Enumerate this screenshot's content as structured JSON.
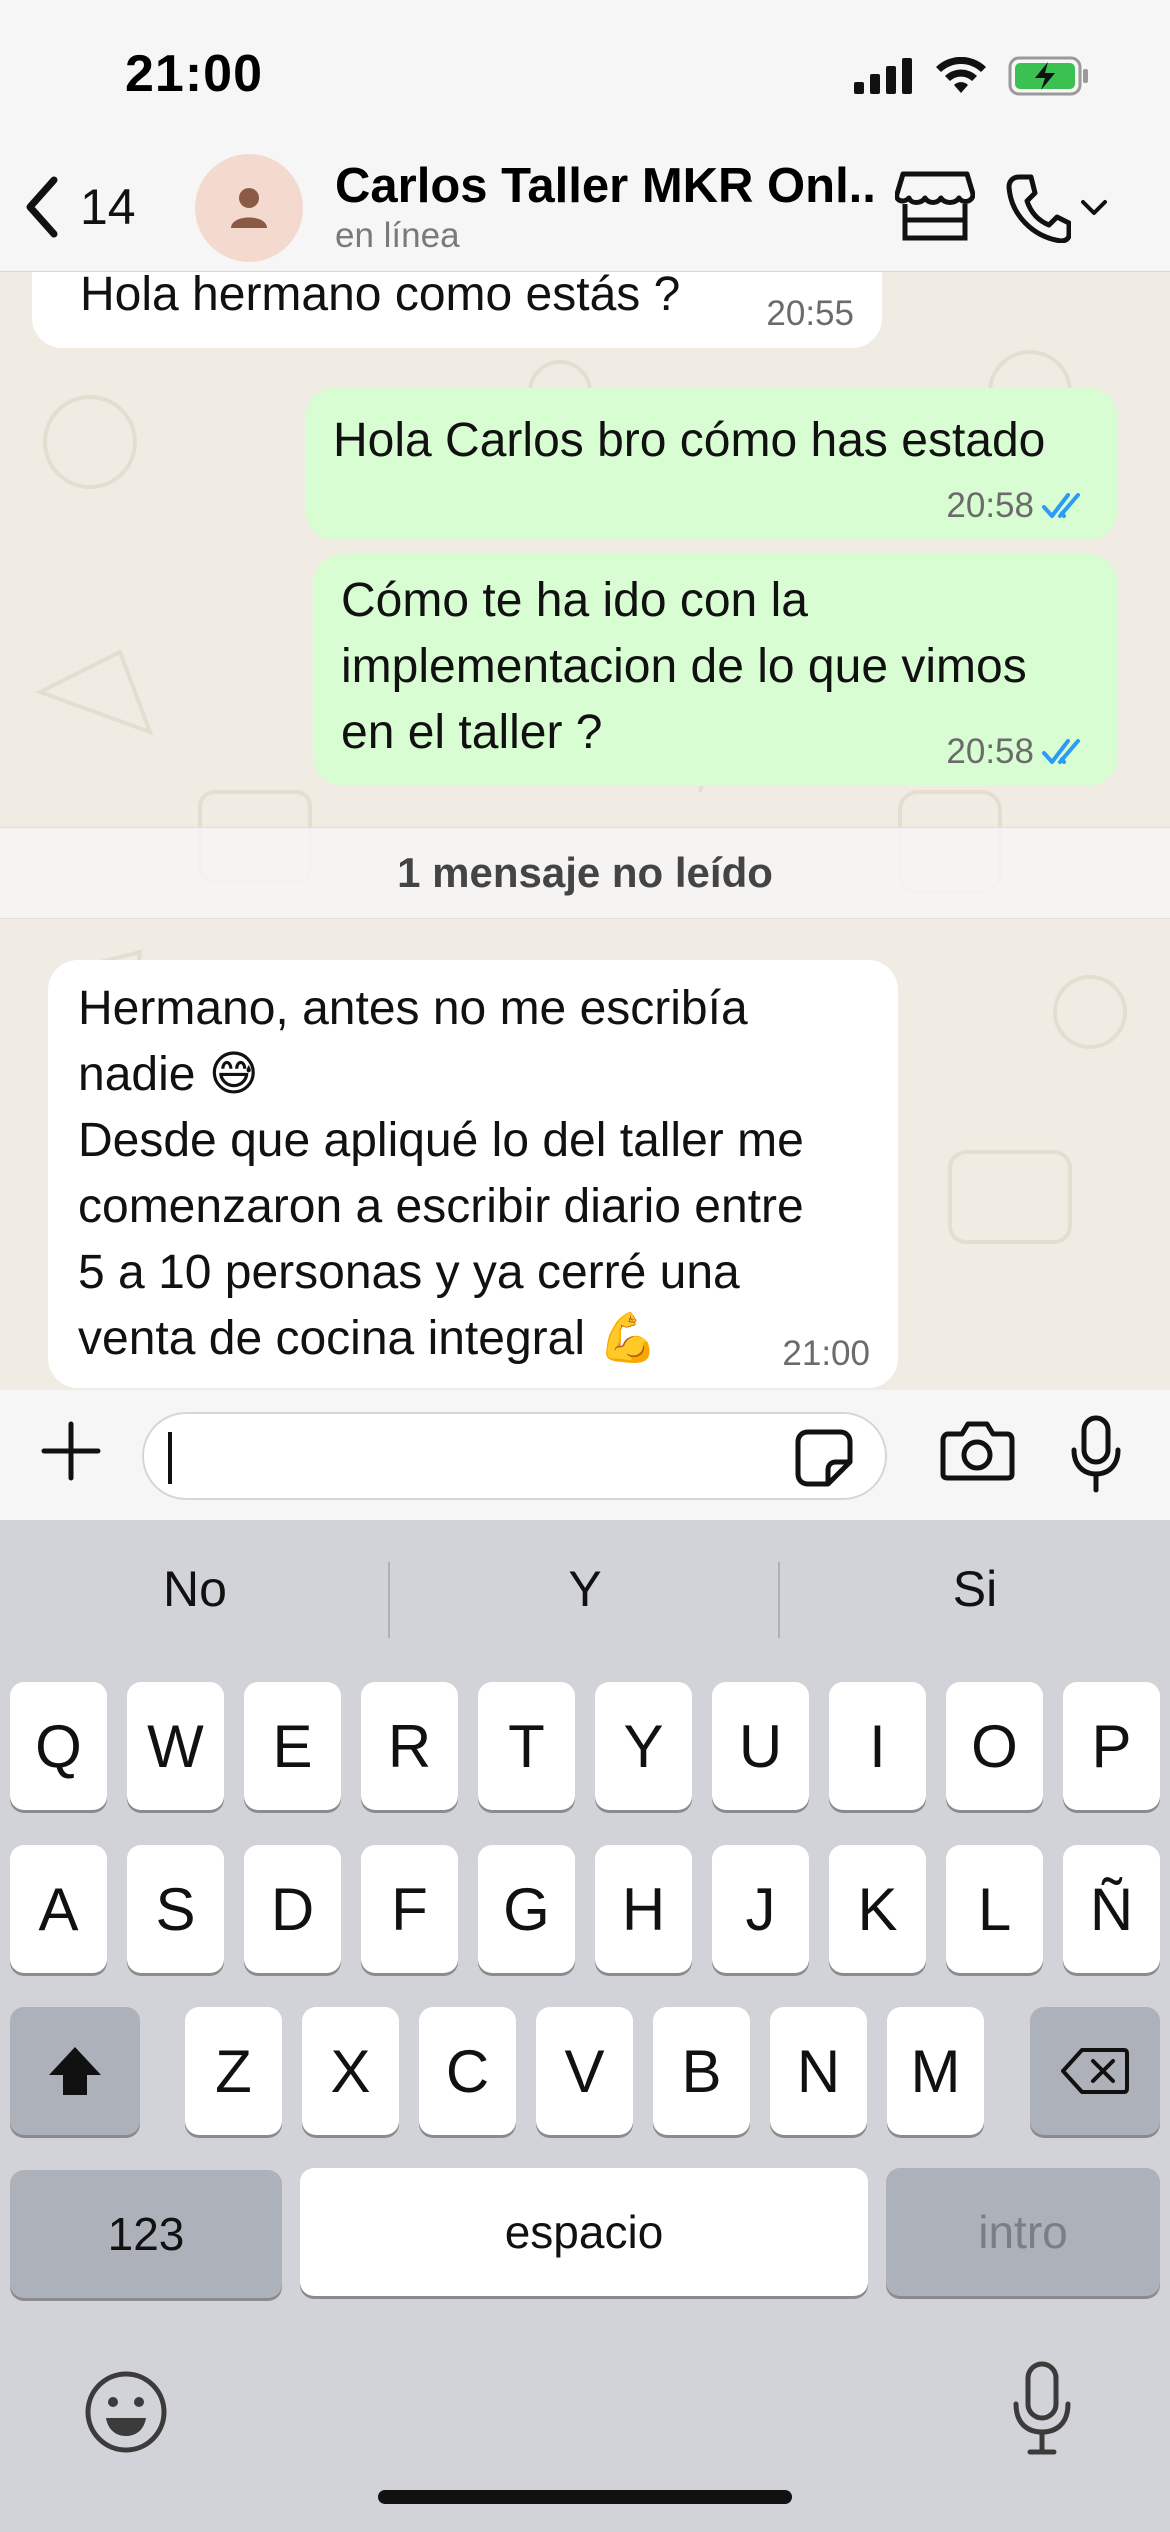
{
  "status_bar": {
    "time": "21:00",
    "icons": [
      "cellular-signal-icon",
      "wifi-icon",
      "battery-charging-icon"
    ]
  },
  "header": {
    "back_count": "14",
    "contact_name": "Carlos Taller MKR Onl...",
    "contact_status": "en línea",
    "icons": [
      "back-chevron-icon",
      "avatar-person-icon",
      "store-icon",
      "phone-icon",
      "chevron-down-icon"
    ]
  },
  "chat": {
    "messages": [
      {
        "direction": "in",
        "text": "Hola hermano como estás ?",
        "time": "20:55"
      },
      {
        "direction": "out",
        "text": "Hola Carlos bro cómo has estado",
        "time": "20:58",
        "status": "read"
      },
      {
        "direction": "out",
        "text": "Cómo te ha ido con la\nimplementacion de lo que vimos\nen el taller ?",
        "time": "20:58",
        "status": "read"
      },
      {
        "direction": "in",
        "text": "Hermano, antes no me escribía\nnadie  😅\nDesde que apliqué lo del taller me\ncomenzaron a escribir diario entre\n5 a 10 personas y  ya cerré una\nventa de cocina integral 💪",
        "time": "21:00"
      }
    ],
    "unread_label": "1 mensaje no leído",
    "colors": {
      "incoming": "#ffffff",
      "outgoing": "#d9fdd3",
      "read_ticks": "#2b9bf4",
      "wallpaper": "#f0ebe3"
    }
  },
  "input_bar": {
    "value": "",
    "icons": [
      "plus-icon",
      "sticker-icon",
      "camera-icon",
      "microphone-icon"
    ]
  },
  "keyboard": {
    "suggestions": [
      "No",
      "Y",
      "Si"
    ],
    "row1": [
      "Q",
      "W",
      "E",
      "R",
      "T",
      "Y",
      "U",
      "I",
      "O",
      "P"
    ],
    "row2": [
      "A",
      "S",
      "D",
      "F",
      "G",
      "H",
      "J",
      "K",
      "L",
      "Ñ"
    ],
    "row3": [
      "Z",
      "X",
      "C",
      "V",
      "B",
      "N",
      "M"
    ],
    "numbers_label": "123",
    "space_label": "espacio",
    "return_label": "intro",
    "icons": [
      "shift-icon",
      "backspace-icon",
      "emoji-icon",
      "dictation-mic-icon"
    ]
  }
}
